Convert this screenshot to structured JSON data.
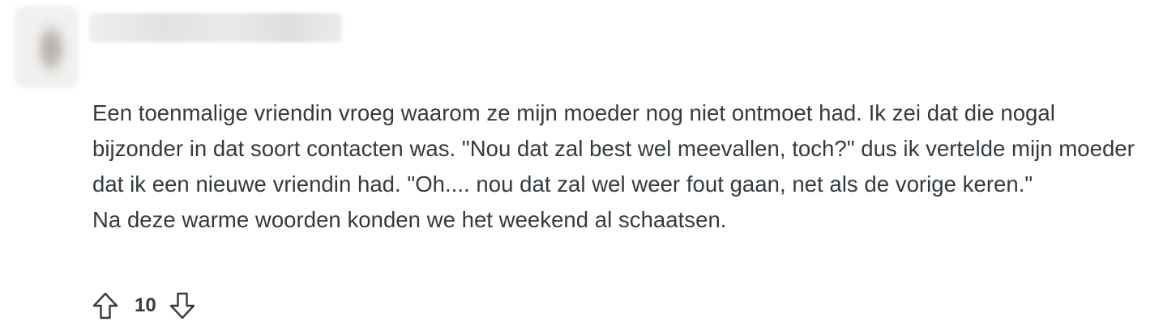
{
  "comment": {
    "paragraphs": [
      "Een toenmalige vriendin vroeg waarom ze mijn moeder nog niet ontmoet had. Ik zei dat die nogal bijzonder in dat soort contacten was. \"Nou dat zal best wel meevallen, toch?\" dus ik vertelde mijn moeder dat ik een nieuwe vriendin had. \"Oh.... nou dat zal wel weer fout gaan, net als de vorige keren.\"",
      "Na deze warme woorden konden we het weekend al schaatsen."
    ],
    "score": "10"
  },
  "icons": {
    "avatar": "avatar-blurred",
    "username": "username-blurred",
    "upvote": "arrow-up-outline-icon",
    "downvote": "arrow-down-outline-icon"
  },
  "colors": {
    "text": "#333a3f",
    "background": "#ffffff"
  }
}
